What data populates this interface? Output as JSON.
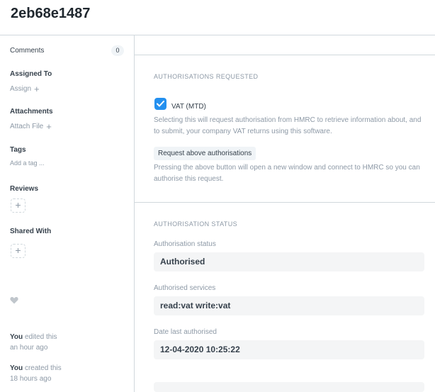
{
  "header": {
    "title": "2eb68e1487"
  },
  "sidebar": {
    "comments_label": "Comments",
    "comments_count": "0",
    "assigned_heading": "Assigned To",
    "assign_link": "Assign",
    "attachments_heading": "Attachments",
    "attach_link": "Attach File",
    "tags_heading": "Tags",
    "tag_placeholder": "Add a tag ...",
    "reviews_heading": "Reviews",
    "shared_heading": "Shared With",
    "activity": [
      {
        "user": "You",
        "action": "edited this",
        "time": "an hour ago"
      },
      {
        "user": "You",
        "action": "created this",
        "time": "18 hours ago"
      }
    ]
  },
  "main": {
    "section1_title": "AUTHORISATIONS REQUESTED",
    "vat_label": "VAT (MTD)",
    "vat_checked": true,
    "vat_description": "Selecting this will request authorisation from HMRC to retrieve information about, and to submit, your company VAT returns using this software.",
    "request_button": "Request above authorisations",
    "request_note": "Pressing the above button will open a new window and connect to HMRC so you can authorise this request.",
    "section2_title": "AUTHORISATION STATUS",
    "fields": [
      {
        "label": "Authorisation status",
        "value": "Authorised"
      },
      {
        "label": "Authorised services",
        "value": "read:vat write:vat"
      },
      {
        "label": "Date last authorised",
        "value": "12-04-2020 10:25:22"
      }
    ]
  },
  "colors": {
    "accent": "#2490ef",
    "border": "#d1d8dd",
    "muted": "#8d99a6"
  }
}
